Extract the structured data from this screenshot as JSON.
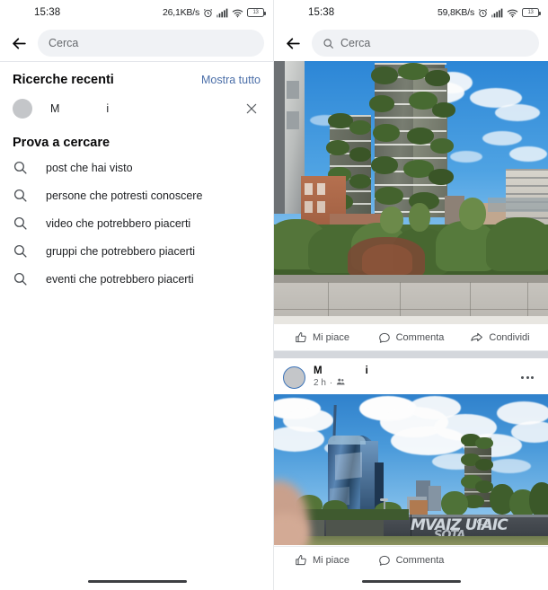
{
  "left": {
    "statusbar": {
      "time": "15:38",
      "network_speed": "26,1KB/s",
      "alarm_icon": "alarm-clock-icon",
      "signal_icon": "signal-bars-icon",
      "wifi_icon": "wifi-icon",
      "battery_level": "13"
    },
    "header": {
      "back_icon": "back-arrow-icon",
      "search_placeholder": "Cerca"
    },
    "recent": {
      "title": "Ricerche recenti",
      "show_all": "Mostra tutto",
      "items": [
        {
          "avatar": "avatar",
          "name_part1": "M",
          "name_part2": "i",
          "remove_icon": "close-icon"
        }
      ]
    },
    "suggestions": {
      "title": "Prova a cercare",
      "items": [
        {
          "icon": "search-icon",
          "label": "post che hai visto"
        },
        {
          "icon": "search-icon",
          "label": "persone che potresti conoscere"
        },
        {
          "icon": "search-icon",
          "label": "video che potrebbero piacerti"
        },
        {
          "icon": "search-icon",
          "label": "gruppi che potrebbero piacerti"
        },
        {
          "icon": "search-icon",
          "label": "eventi che potrebbero piacerti"
        }
      ]
    }
  },
  "right": {
    "statusbar": {
      "time": "15:38",
      "network_speed": "59,8KB/s",
      "alarm_icon": "alarm-clock-icon",
      "signal_icon": "signal-bars-icon",
      "wifi_icon": "wifi-icon",
      "battery_level": "13"
    },
    "header": {
      "back_icon": "back-arrow-icon",
      "search_icon": "search-icon",
      "search_placeholder": "Cerca"
    },
    "post1": {
      "photo_alt": "Bosco Verticale towers with hedges and stone wall",
      "actions": [
        {
          "icon": "thumbs-up-icon",
          "label": "Mi piace"
        },
        {
          "icon": "comment-bubble-icon",
          "label": "Commenta"
        },
        {
          "icon": "share-arrow-icon",
          "label": "Condividi"
        }
      ]
    },
    "post2": {
      "author_part1": "M",
      "author_part2": "i",
      "time": "2 h",
      "audience_icon": "friends-icon",
      "menu_icon": "more-options-icon",
      "photo_alt": "Unicredit Tower skyline with clouds and graffiti wall",
      "actions": [
        {
          "icon": "thumbs-up-icon",
          "label": "Mi piace"
        },
        {
          "icon": "comment-bubble-icon",
          "label": "Commenta"
        }
      ]
    }
  },
  "colors": {
    "link_blue": "#4a6ea8",
    "ring_blue": "#3b73b9",
    "field_gray": "#f0f2f5",
    "separator": "#d4d7dc"
  }
}
